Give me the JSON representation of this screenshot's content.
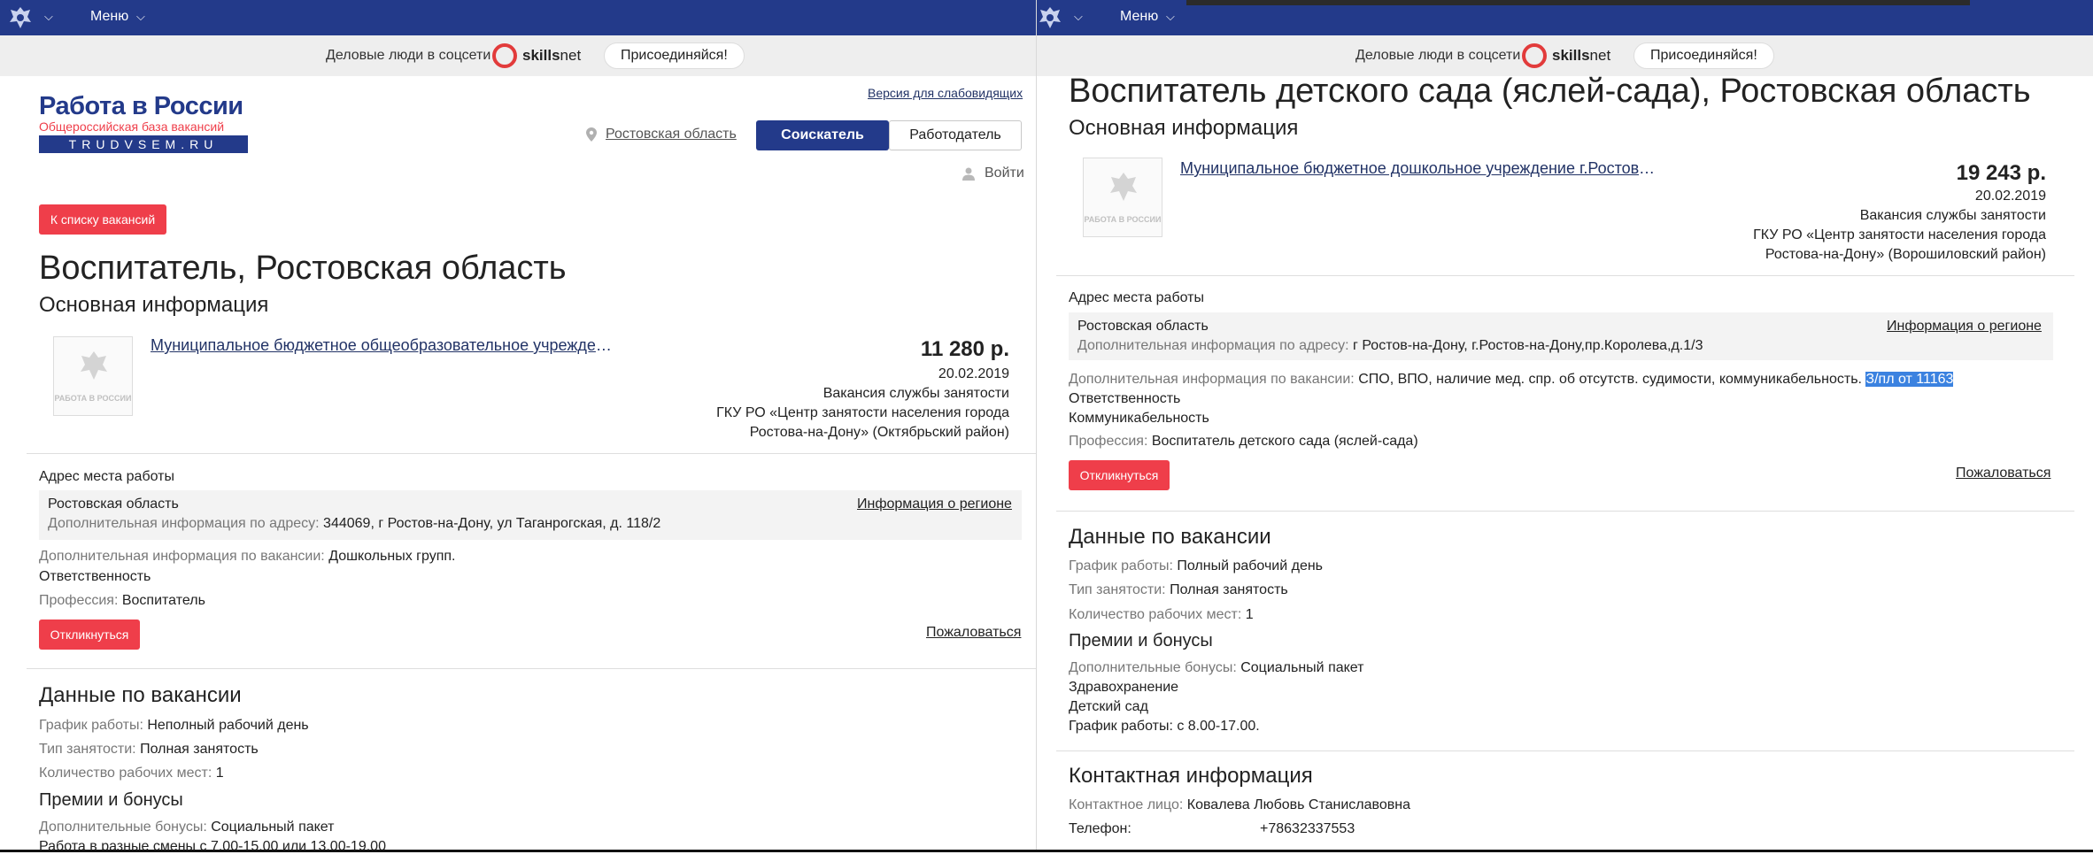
{
  "header": {
    "menu_label": "Меню",
    "chevron": "⌵",
    "emblem_icon": "coat-of-arms-icon",
    "banner_text": "Деловые люди в соцсети",
    "skillsnet_logo_a": "skills",
    "skillsnet_logo_b": "net",
    "join_label": "Присоединяйся!"
  },
  "left": {
    "logo": {
      "title": "Работа в России",
      "subtitle": "Общероссийская база вакансий",
      "domain": "TRUDVSEM.RU"
    },
    "accessibility_link": "Версия для слабовидящих",
    "region_link": "Ростовская область",
    "seeker_tab": "Соискатель",
    "employer_tab": "Работодатель",
    "login_label": "Войти",
    "back_button": "К списку вакансий",
    "vacancy_title": "Воспитатель, Ростовская область",
    "section_main": "Основная информация",
    "org_logo_caption": "РАБОТА В РОССИИ",
    "org_name": "Муниципальное бюджетное общеобразовательное учреждение средняя общеобразовательная школа",
    "salary": "11 280 р.",
    "date": "20.02.2019",
    "source": "Вакансия службы занятости",
    "agency_line1": "ГКУ РО «Центр занятости населения города",
    "agency_line2": "Ростова-на-Дону» (Октябрьский район)",
    "address_section": "Адрес места работы",
    "address_region": "Ростовская область",
    "region_info_link": "Информация о регионе",
    "address_extra_label": "Дополнительная информация по адресу:",
    "address_extra_value": "344069, г Ростов-на-Дону, ул Таганрогская, д. 118/2",
    "extra_info_label": "Дополнительная информация по вакансии:",
    "extra_info_value": "Дошкольных групп.",
    "extra_line2": "Ответственность",
    "profession_label": "Профессия:",
    "profession_value": "Воспитатель",
    "respond_button": "Откликнуться",
    "complain_link": "Пожаловаться",
    "section_data": "Данные по вакансии",
    "schedule_label": "График работы:",
    "schedule_value": "Неполный рабочий день",
    "employment_label": "Тип занятости:",
    "employment_value": "Полная занятость",
    "places_label": "Количество рабочих мест:",
    "places_value": "1",
    "bonus_section": "Премии и бонусы",
    "bonus_label": "Дополнительные бонусы:",
    "bonus_value": "Социальный пакет",
    "bonus_line2": "Работа в разные смены с 7.00-15.00 или 13.00-19.00"
  },
  "right": {
    "vacancy_title": "Воспитатель детского сада (яслей-сада), Ростовская область",
    "section_main": "Основная информация",
    "org_logo_caption": "РАБОТА В РОССИИ",
    "org_name": "Муниципальное бюджетное дошкольное учреждение г.Ростова-на-Дону детский сад",
    "salary": "19 243 р.",
    "date": "20.02.2019",
    "source": "Вакансия службы занятости",
    "agency_line1": "ГКУ РО «Центр занятости населения города",
    "agency_line2": "Ростова-на-Дону» (Ворошиловский район)",
    "address_section": "Адрес места работы",
    "address_region": "Ростовская область",
    "region_info_link": "Информация о регионе",
    "address_extra_label": "Дополнительная информация по адресу:",
    "address_extra_value": "г Ростов-на-Дону, г.Ростов-на-Дону,пр.Королева,д.1/3",
    "extra_info_label": "Дополнительная информация по вакансии:",
    "extra_info_value": "СПО, ВПО, наличие мед. спр. об отсутств. судимости, коммуникабельность.",
    "extra_info_selected": "З/пл от 11163",
    "extra_line2": "Ответственность",
    "extra_line3": "Коммуникабельность",
    "profession_label": "Профессия:",
    "profession_value": "Воспитатель детского сада (яслей-сада)",
    "respond_button": "Откликнуться",
    "complain_link": "Пожаловаться",
    "section_data": "Данные по вакансии",
    "schedule_label": "График работы:",
    "schedule_value": "Полный рабочий день",
    "employment_label": "Тип занятости:",
    "employment_value": "Полная занятость",
    "places_label": "Количество рабочих мест:",
    "places_value": "1",
    "bonus_section": "Премии и бонусы",
    "bonus_label": "Дополнительные бонусы:",
    "bonus_value": "Социальный пакет",
    "bonus_line2": "Здравохранение",
    "bonus_line3": "Детский сад",
    "bonus_line4": "График работы: с 8.00-17.00.",
    "contact_section": "Контактная информация",
    "contact_label": "Контактное лицо:",
    "contact_value": "Ковалева Любовь Станиславовна",
    "phone_label": "Телефон:",
    "phone_value": "+78632337553"
  },
  "colors": {
    "nav": "#233a8a",
    "accent_red": "#ef3e4a",
    "banner_bg": "#eeeeee"
  }
}
